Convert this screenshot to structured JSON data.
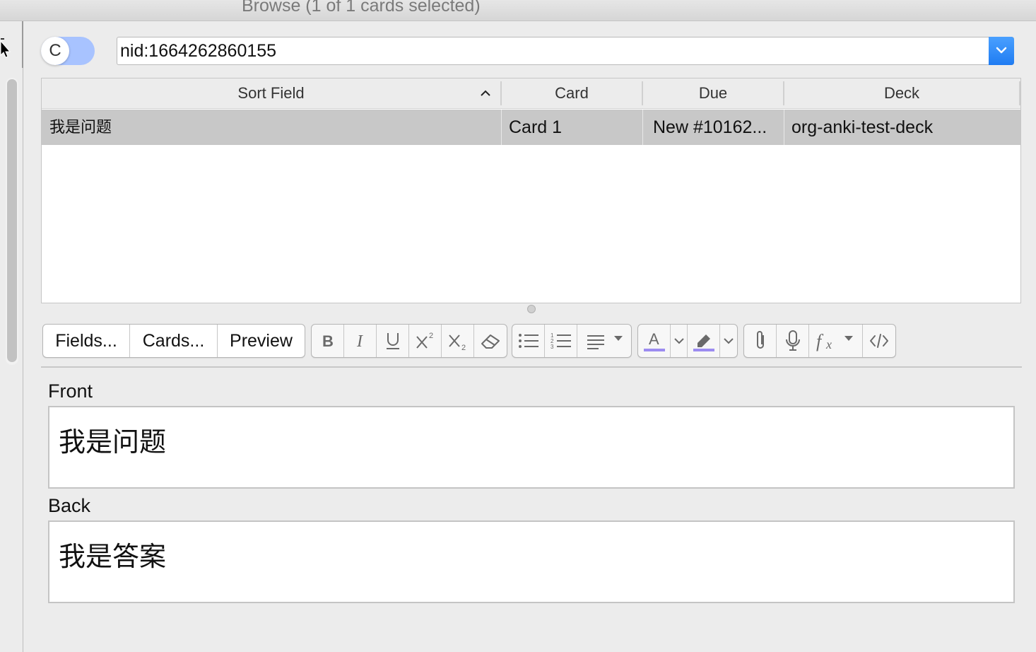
{
  "window": {
    "title": "Browse (1 of 1 cards selected)"
  },
  "toggle": {
    "label": "C"
  },
  "search": {
    "value": "nid:1664262860155"
  },
  "table": {
    "columns": [
      "Sort Field",
      "Card",
      "Due",
      "Deck"
    ],
    "rows": [
      {
        "sort_field": "我是问题",
        "card": "Card 1",
        "due": "New #10162...",
        "deck": "org-anki-test-deck"
      }
    ]
  },
  "editor": {
    "buttons": {
      "fields": "Fields...",
      "cards": "Cards...",
      "preview": "Preview"
    },
    "format_icons": [
      "bold-icon",
      "italic-icon",
      "underline-icon",
      "superscript-icon",
      "subscript-icon",
      "eraser-icon"
    ],
    "list_icons": [
      "bullet-list-icon",
      "numbered-list-icon",
      "align-icon"
    ],
    "color_icons": [
      "text-color-icon",
      "highlight-icon"
    ],
    "media_icons": [
      "paperclip-icon",
      "microphone-icon",
      "function-icon",
      "html-code-icon"
    ],
    "accent_color": "#9c8cf0",
    "fields": [
      {
        "name": "Front",
        "value": "我是问题"
      },
      {
        "name": "Back",
        "value": "我是答案"
      }
    ]
  }
}
